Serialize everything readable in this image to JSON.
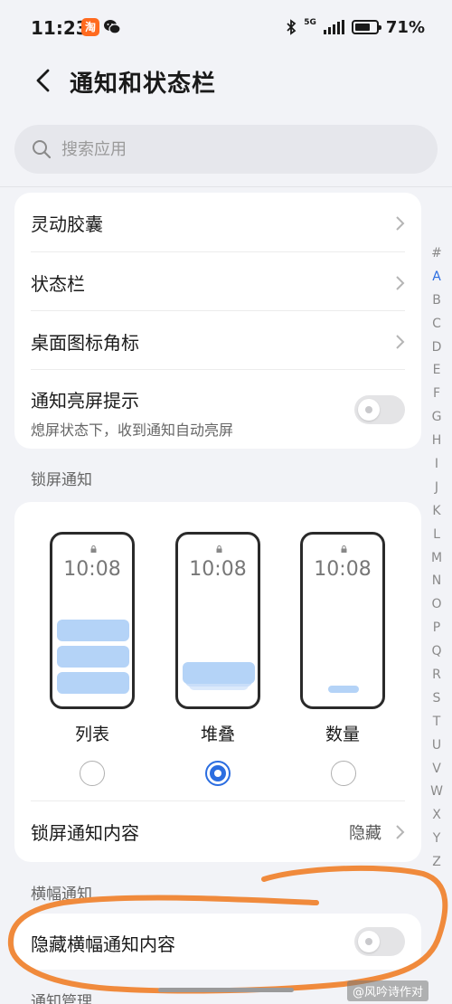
{
  "status_bar": {
    "time": "11:23",
    "network": "5G",
    "battery_percent": "71%",
    "battery_level": 0.71,
    "icons": [
      "taobao-icon",
      "wechat-icon",
      "bluetooth-icon",
      "signal-icon",
      "battery-icon"
    ]
  },
  "header": {
    "title": "通知和状态栏"
  },
  "search": {
    "placeholder": "搜索应用"
  },
  "settings_card": {
    "items": [
      {
        "label": "灵动胶囊"
      },
      {
        "label": "状态栏"
      },
      {
        "label": "桌面图标角标"
      },
      {
        "label": "通知亮屏提示",
        "subtitle": "熄屏状态下，收到通知自动亮屏",
        "toggle": false
      }
    ]
  },
  "lock_screen": {
    "section_label": "锁屏通知",
    "clock": "10:08",
    "styles": [
      {
        "label": "列表",
        "selected": false
      },
      {
        "label": "堆叠",
        "selected": true
      },
      {
        "label": "数量",
        "selected": false
      }
    ],
    "content_row": {
      "label": "锁屏通知内容",
      "value": "隐藏"
    }
  },
  "banner": {
    "section_label": "横幅通知",
    "hide_content": {
      "label": "隐藏横幅通知内容",
      "toggle": false
    }
  },
  "next_section_label": "通知管理",
  "alphabet_index": [
    "#",
    "A",
    "B",
    "C",
    "D",
    "E",
    "F",
    "G",
    "H",
    "I",
    "J",
    "K",
    "L",
    "M",
    "N",
    "O",
    "P",
    "Q",
    "R",
    "S",
    "T",
    "U",
    "V",
    "W",
    "X",
    "Y",
    "Z"
  ],
  "alphabet_active": "A",
  "watermark": "@风吟诗作对",
  "colors": {
    "accent": "#2b6de0",
    "notification_bar": "#b4d3f7",
    "annotation": "#f08a3c",
    "background": "#f2f3f7"
  }
}
